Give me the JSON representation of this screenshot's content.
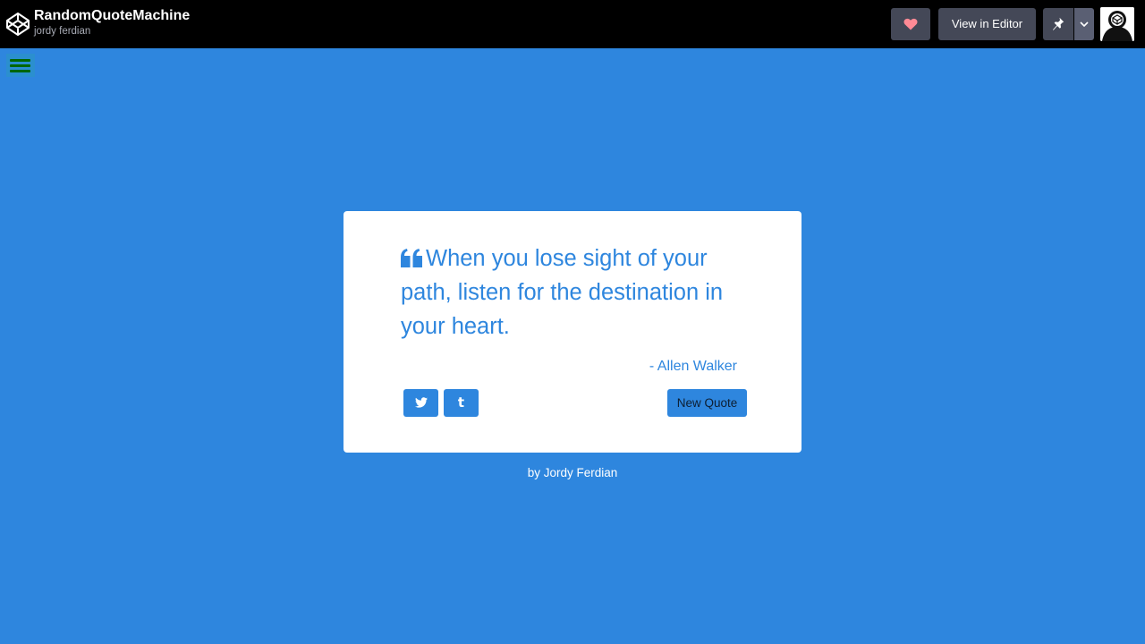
{
  "app": {
    "pen_title": "RandomQuoteMachine",
    "author": "jordy ferdian",
    "logo_icon": "codepen-logo-icon"
  },
  "toolbar": {
    "heart_icon": "heart-icon",
    "view_in_editor_label": "View in Editor",
    "pin_icon": "pin-icon",
    "dropdown_icon": "chevron-down-icon",
    "avatar_icon": "user-avatar"
  },
  "menu": {
    "hamburger_icon": "menu-icon"
  },
  "quote": {
    "text": "When you lose sight of your path, listen for the destination in your heart.",
    "author": "- Allen Walker",
    "quote_icon": "quote-left-icon"
  },
  "actions": {
    "twitter_icon": "twitter-icon",
    "tumblr_icon": "tumblr-icon",
    "tumblr_glyph": "t",
    "new_quote_label": "New Quote"
  },
  "footer": {
    "credit": "by Jordy Ferdian"
  },
  "colors": {
    "background": "#2e86de",
    "topbar": "#000000",
    "card": "#ffffff",
    "accent": "#2e86de",
    "heart": "#ff8a95",
    "menu_bars": "#006600"
  }
}
